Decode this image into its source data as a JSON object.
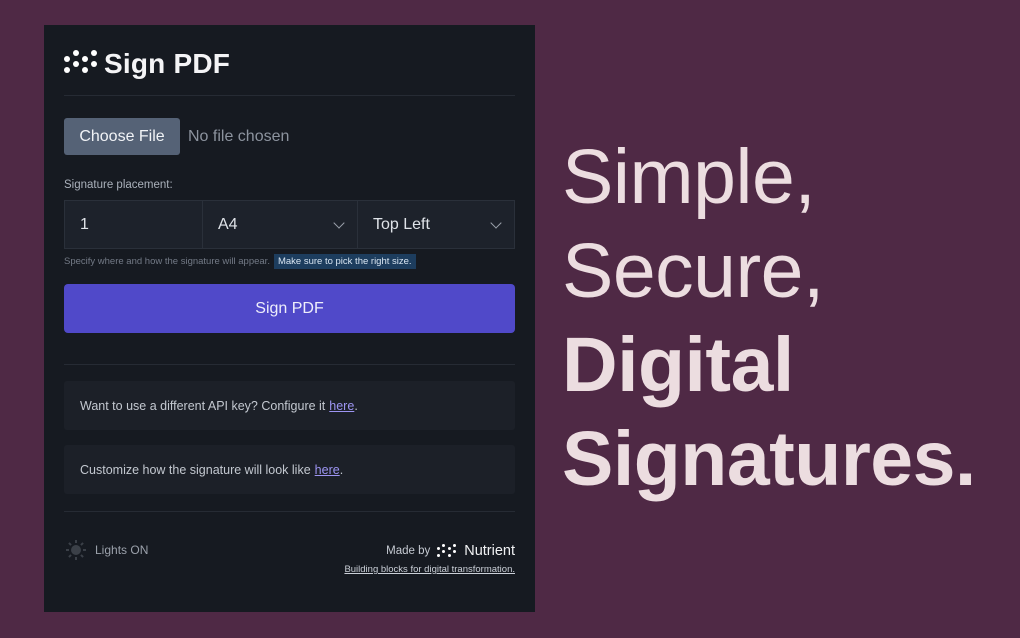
{
  "app": {
    "title": "Sign PDF",
    "logo_icon": "dots-logo-icon"
  },
  "file_input": {
    "button_label": "Choose File",
    "status_text": "No file chosen"
  },
  "placement": {
    "label": "Signature placement:",
    "page_value": "1",
    "size_value": "A4",
    "position_value": "Top Left",
    "hint_text": "Specify where and how the signature will appear.",
    "hint_highlight": "Make sure to pick the right size."
  },
  "sign_button": {
    "label": "Sign PDF"
  },
  "info": {
    "api_key_text": "Want to use a different API key? Configure it",
    "api_key_link": "here",
    "customize_text": "Customize how the signature will look like",
    "customize_link": "here",
    "period": "."
  },
  "footer": {
    "lights_label": "Lights ON",
    "lights_icon": "sun-icon",
    "made_by": "Made by",
    "company": "Nutrient",
    "tagline": "Building blocks for digital transformation."
  },
  "promo": {
    "line1": "Simple,",
    "line2": "Secure,",
    "line3": "Digital",
    "line4": "Signatures."
  },
  "colors": {
    "background": "#4f2945",
    "panel": "#161a21",
    "primary_button": "#5049c9",
    "link": "#9d95f3",
    "headline": "#ecdde0"
  }
}
